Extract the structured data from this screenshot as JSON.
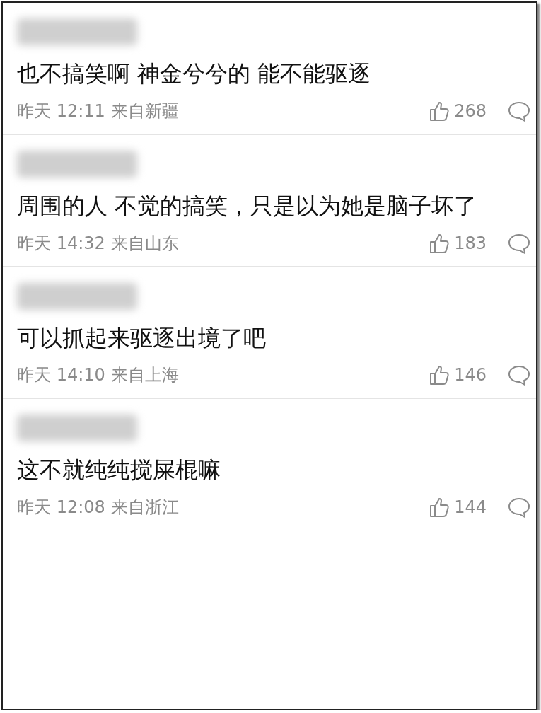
{
  "comments": [
    {
      "text": "也不搞笑啊 神金兮兮的 能不能驱逐",
      "time": "昨天 12:11",
      "location": "来自新疆",
      "likes": "268"
    },
    {
      "text": "周围的人 不觉的搞笑，只是以为她是脑子坏了",
      "time": "昨天 14:32",
      "location": "来自山东",
      "likes": "183"
    },
    {
      "text": "可以抓起来驱逐出境了吧",
      "time": "昨天 14:10",
      "location": "来自上海",
      "likes": "146"
    },
    {
      "text": "这不就纯纯搅屎棍嘛",
      "time": "昨天 12:08",
      "location": "来自浙江",
      "likes": "144"
    }
  ]
}
